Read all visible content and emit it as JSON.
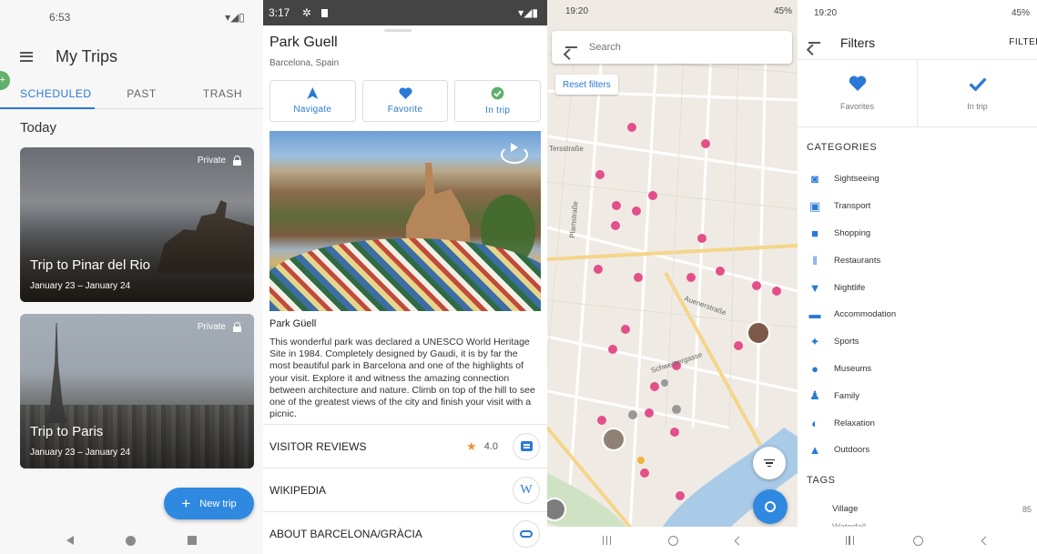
{
  "trips_screen": {
    "status": {
      "time": "6:53"
    },
    "title": "My Trips",
    "fab_mini": "+",
    "tabs": [
      "SCHEDULED",
      "PAST",
      "TRASH"
    ],
    "section_today": "Today",
    "cards": [
      {
        "title": "Trip to Pinar del Rio",
        "dates": "January 23 – January 24",
        "privacy": "Private"
      },
      {
        "title": "Trip to Paris",
        "dates": "January 23 – January 24",
        "privacy": "Private"
      }
    ],
    "new_trip_plus": "+",
    "new_trip_label": "New trip"
  },
  "place_screen": {
    "status": {
      "time": "3:17"
    },
    "name": "Park Guell",
    "location": "Barcelona, Spain",
    "actions": [
      {
        "label": "Navigate",
        "icon": "navigate-icon"
      },
      {
        "label": "Favorite",
        "icon": "heart-icon"
      },
      {
        "label": "In trip",
        "icon": "check-circle-icon"
      }
    ],
    "photo_caption": "Park Güell",
    "description": "This wonderful park was declared a UNESCO World Heritage Site in 1984. Completely designed by Gaudi, it is by far the most beautiful park in Barcelona and one of the highlights of your visit. Explore it and witness the amazing connection between architecture and nature. Climb on top of the hill to see one of the greatest views of the city and finish your visit with a picnic.",
    "rows": [
      {
        "label": "VISITOR REVIEWS",
        "rating": "4.0"
      },
      {
        "label": "WIKIPEDIA",
        "icon_text": "W"
      },
      {
        "label": "ABOUT BARCELONA/GRÀCIA"
      }
    ],
    "colors": {
      "accent": "#2a79d6",
      "star": "#e8953a"
    }
  },
  "map_screen": {
    "status": {
      "time": "19:20",
      "right": "45%"
    },
    "search_placeholder": "Search",
    "reset_filters": "Reset filters",
    "street_labels": [
      "Tersstraße",
      "Plamstraße",
      "Auenerstraße",
      "Schweinergasse"
    ]
  },
  "filters_screen": {
    "status": {
      "time": "19:20",
      "right": "45%"
    },
    "title": "Filters",
    "apply": "FILTER",
    "toggles": [
      {
        "label": "Favorites",
        "icon": "heart-icon"
      },
      {
        "label": "In trip",
        "icon": "check-icon"
      }
    ],
    "categories_header": "CATEGORIES",
    "categories": [
      {
        "label": "Sightseeing",
        "icon": "camera-icon"
      },
      {
        "label": "Transport",
        "icon": "bus-icon"
      },
      {
        "label": "Shopping",
        "icon": "bag-icon"
      },
      {
        "label": "Restaurants",
        "icon": "cutlery-icon"
      },
      {
        "label": "Nightlife",
        "icon": "cocktail-icon"
      },
      {
        "label": "Accommodation",
        "icon": "bed-icon"
      },
      {
        "label": "Sports",
        "icon": "runner-icon"
      },
      {
        "label": "Museums",
        "icon": "bulb-icon"
      },
      {
        "label": "Family",
        "icon": "family-icon"
      },
      {
        "label": "Relaxation",
        "icon": "relax-icon"
      },
      {
        "label": "Outdoors",
        "icon": "tent-icon"
      }
    ],
    "tags_header": "TAGS",
    "tags": [
      {
        "label": "Village",
        "count": "85"
      },
      {
        "label": "Waterfall",
        "count": ""
      }
    ]
  }
}
